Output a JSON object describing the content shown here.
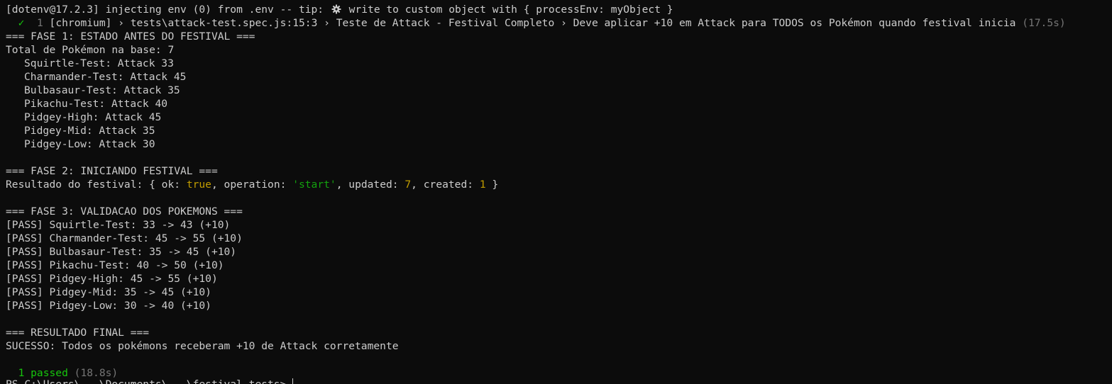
{
  "dotenv": {
    "prefix": "[dotenv@17.2.3] injecting env (0) from .env -- tip: ",
    "gear_icon": "gear-icon",
    "suffix": " write to custom object with { processEnv: myObject }"
  },
  "test_header": {
    "check": "✓",
    "index": "1",
    "path": "[chromium] › tests\\attack-test.spec.js:15:3 › Teste de Attack - Festival Completo › Deve aplicar +10 em Attack para TODOS os Pokémon quando festival inicia",
    "duration": "(17.5s)"
  },
  "phase1": {
    "title": "=== FASE 1: ESTADO ANTES DO FESTIVAL ===",
    "total": "Total de Pokémon na base: 7",
    "pokemon": [
      "Squirtle-Test: Attack 33",
      "Charmander-Test: Attack 45",
      "Bulbasaur-Test: Attack 35",
      "Pikachu-Test: Attack 40",
      "Pidgey-High: Attack 45",
      "Pidgey-Mid: Attack 35",
      "Pidgey-Low: Attack 30"
    ]
  },
  "phase2": {
    "title": "=== FASE 2: INICIANDO FESTIVAL ===",
    "result_prefix": "Resultado do festival: { ok: ",
    "ok_value": "true",
    "operation_key": ", operation: ",
    "operation_value": "'start'",
    "updated_key": ", updated: ",
    "updated_value": "7",
    "created_key": ", created: ",
    "created_value": "1",
    "result_suffix": " }"
  },
  "phase3": {
    "title": "=== FASE 3: VALIDACAO DOS POKEMONS ===",
    "results": [
      "[PASS] Squirtle-Test: 33 -> 43 (+10)",
      "[PASS] Charmander-Test: 45 -> 55 (+10)",
      "[PASS] Bulbasaur-Test: 35 -> 45 (+10)",
      "[PASS] Pikachu-Test: 40 -> 50 (+10)",
      "[PASS] Pidgey-High: 45 -> 55 (+10)",
      "[PASS] Pidgey-Mid: 35 -> 45 (+10)",
      "[PASS] Pidgey-Low: 30 -> 40 (+10)"
    ]
  },
  "final": {
    "title": "=== RESULTADO FINAL ===",
    "message": "SUCESSO: Todos os pokémons receberam +10 de Attack corretamente"
  },
  "summary": {
    "passed": "1 passed",
    "duration": "(18.8s)"
  },
  "prompt": {
    "text": "PS C:\\Users\\...\\Documents\\...\\festival-tests> "
  },
  "colors": {
    "background": "#0c0c0c",
    "foreground": "#cccccc",
    "success_green": "#16c60c",
    "dim_gray": "#767676",
    "value_yellow": "#c19c00",
    "string_green": "#13a10e"
  }
}
